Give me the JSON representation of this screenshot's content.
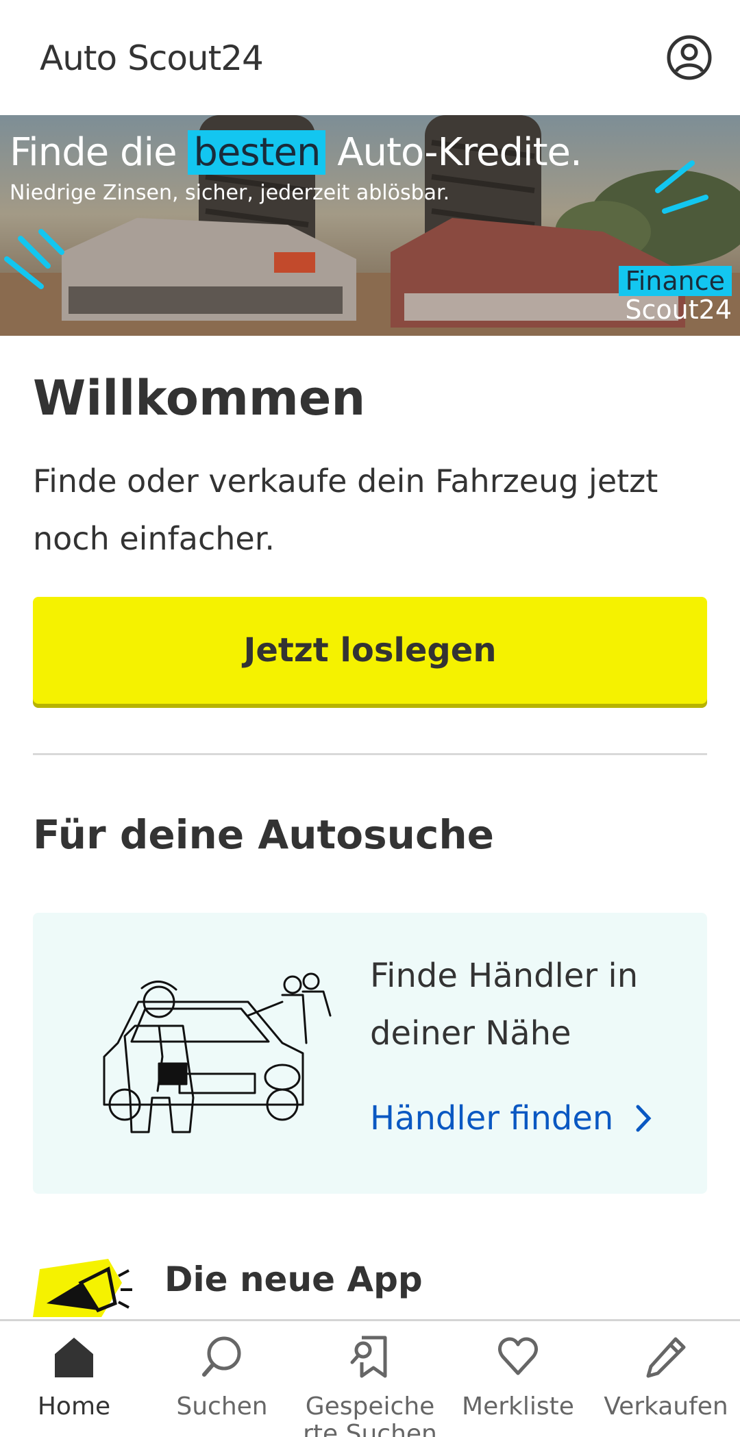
{
  "header": {
    "logo_auto": "Auto",
    "logo_scout": "Scout24",
    "profile_icon": "user-circle-icon"
  },
  "banner": {
    "headline_pre": "Finde die ",
    "headline_highlight": "besten",
    "headline_post": " Auto-Kredite.",
    "subline": "Niedrige Zinsen, sicher, jederzeit ablösbar.",
    "brand_top": "Finance",
    "brand_bottom": "Scout24",
    "accent_color": "#13c6f0"
  },
  "welcome": {
    "title": "Willkommen",
    "text": "Finde oder verkaufe dein Fahrzeug jetzt noch einfacher.",
    "cta_label": "Jetzt loslegen"
  },
  "autosuche": {
    "title": "Für deine Autosuche",
    "dealer_text": "Finde Händler in deiner Nähe",
    "dealer_link": "Händler finden"
  },
  "app": {
    "title": "Die neue App",
    "icon": "megaphone-icon"
  },
  "bottom_nav": {
    "items": [
      {
        "label": "Home",
        "icon": "home-icon",
        "active": true
      },
      {
        "label": "Suchen",
        "icon": "search-icon",
        "active": false
      },
      {
        "label": "Gespeiche\nrte Suchen",
        "icon": "saved-search-icon",
        "active": false
      },
      {
        "label": "Merkliste",
        "icon": "heart-icon",
        "active": false
      },
      {
        "label": "Verkaufen",
        "icon": "pencil-icon",
        "active": false
      }
    ]
  },
  "colors": {
    "brand_yellow": "#f5f200",
    "link_blue": "#0a58c2",
    "card_bg": "#eefaf9"
  }
}
